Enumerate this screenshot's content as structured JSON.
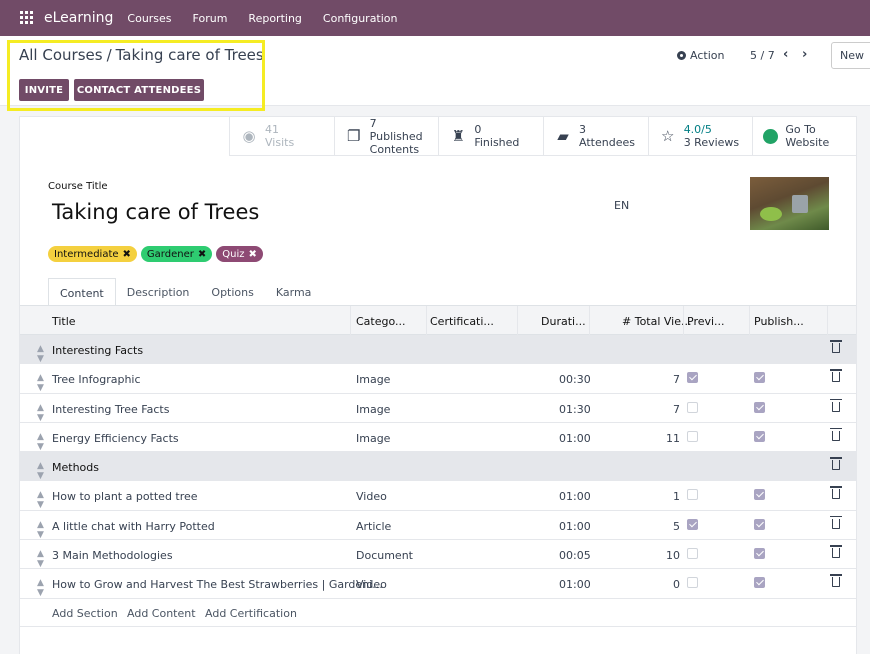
{
  "nav": {
    "app_name": "eLearning",
    "items": [
      "Courses",
      "Forum",
      "Reporting",
      "Configuration"
    ]
  },
  "control": {
    "breadcrumb_parent": "All Courses",
    "breadcrumb_sep": "/",
    "breadcrumb_current": "Taking care of Trees",
    "invite_label": "INVITE",
    "contact_label": "CONTACT ATTENDEES",
    "action_label": "Action",
    "pager": "5 / 7",
    "new_label": "New"
  },
  "stats": [
    {
      "icon": "eye-icon",
      "value": "41",
      "label": "Visits"
    },
    {
      "icon": "copy-icon",
      "value": "7",
      "label": "Published",
      "label2": "Contents"
    },
    {
      "icon": "trophy-icon",
      "value": "0",
      "label": "Finished"
    },
    {
      "icon": "graduation-cap-icon",
      "value": "3",
      "label": "Attendees"
    },
    {
      "icon": "star-icon",
      "value": "4.0/5",
      "label": "3 Reviews"
    },
    {
      "icon": "globe-icon",
      "value": "Go To",
      "label": "Website"
    }
  ],
  "course": {
    "title_label": "Course Title",
    "title": "Taking care of Trees",
    "lang": "EN",
    "tags": [
      {
        "label": "Intermediate",
        "color": "#f4d03f"
      },
      {
        "label": "Gardener",
        "color": "#2ecc71"
      },
      {
        "label": "Quiz",
        "color": "#8e4a74"
      }
    ]
  },
  "tabs": [
    "Content",
    "Description",
    "Options",
    "Karma"
  ],
  "table": {
    "headers": [
      "Title",
      "Catego...",
      "Certificati...",
      "Durati...",
      "# Total Vie...",
      "Previ...",
      "Publish..."
    ],
    "rows": [
      {
        "section": true,
        "title": "Interesting Facts"
      },
      {
        "title": "Tree Infographic",
        "category": "Image",
        "duration": "00:30",
        "views": "7",
        "preview": true,
        "published": true
      },
      {
        "title": "Interesting Tree Facts",
        "category": "Image",
        "duration": "01:30",
        "views": "7",
        "preview": false,
        "published": true
      },
      {
        "title": "Energy Efficiency Facts",
        "category": "Image",
        "duration": "01:00",
        "views": "11",
        "preview": false,
        "published": true
      },
      {
        "section": true,
        "title": "Methods"
      },
      {
        "title": "How to plant a potted tree",
        "category": "Video",
        "duration": "01:00",
        "views": "1",
        "preview": false,
        "published": true
      },
      {
        "title": "A little chat with Harry Potted",
        "category": "Article",
        "duration": "01:00",
        "views": "5",
        "preview": true,
        "published": true
      },
      {
        "title": "3 Main Methodologies",
        "category": "Document",
        "duration": "00:05",
        "views": "10",
        "preview": false,
        "published": true
      },
      {
        "title": "How to Grow and Harvest The Best Strawberries | Gardeni...",
        "category": "Video",
        "duration": "01:00",
        "views": "0",
        "preview": false,
        "published": true
      }
    ],
    "add_section": "Add Section",
    "add_content": "Add Content",
    "add_certification": "Add Certification"
  },
  "colors": {
    "brand": "#714b67",
    "highlight": "#f5ec23"
  }
}
